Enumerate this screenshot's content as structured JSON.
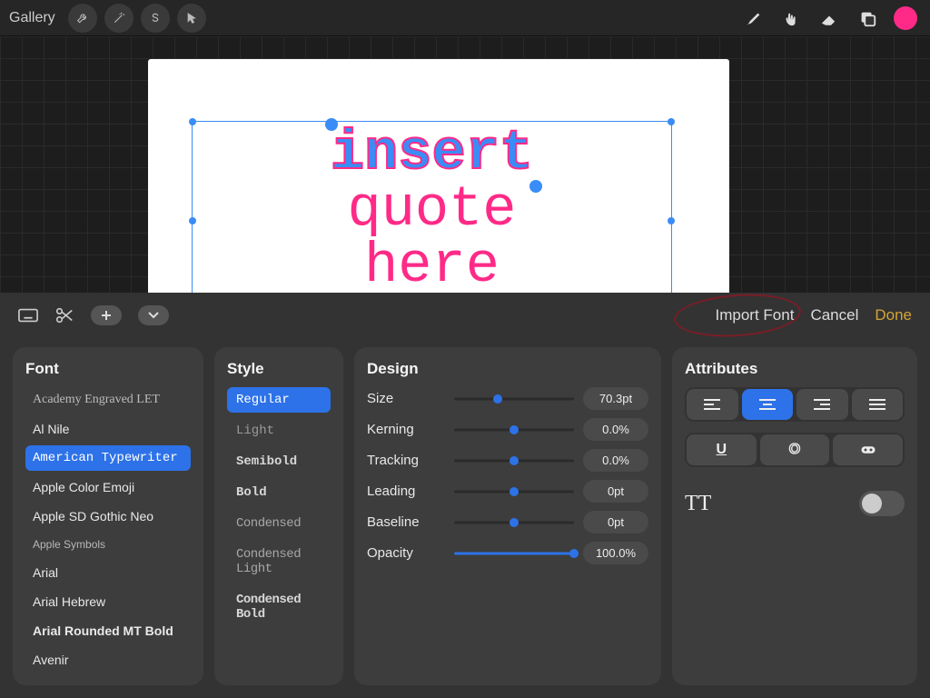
{
  "topbar": {
    "gallery_label": "Gallery"
  },
  "canvas": {
    "selected_word": "insert",
    "line2": "quote",
    "line3": "here"
  },
  "panel_toolbar": {
    "import_font": "Import Font",
    "cancel": "Cancel",
    "done": "Done"
  },
  "font_panel": {
    "title": "Font",
    "items": [
      "Academy Engraved LET",
      "Al Nile",
      "American Typewriter",
      "Apple Color Emoji",
      "Apple SD Gothic Neo",
      "Apple Symbols",
      "Arial",
      "Arial Hebrew",
      "Arial Rounded MT Bold",
      "Avenir"
    ],
    "selected_index": 2
  },
  "style_panel": {
    "title": "Style",
    "items": [
      "Regular",
      "Light",
      "Semibold",
      "Bold",
      "Condensed",
      "Condensed Light",
      "Condensed Bold"
    ],
    "selected_index": 0
  },
  "design_panel": {
    "title": "Design",
    "rows": [
      {
        "label": "Size",
        "value": "70.3pt",
        "thumb_pct": 36
      },
      {
        "label": "Kerning",
        "value": "0.0%",
        "thumb_pct": 50
      },
      {
        "label": "Tracking",
        "value": "0.0%",
        "thumb_pct": 50
      },
      {
        "label": "Leading",
        "value": "0pt",
        "thumb_pct": 50
      },
      {
        "label": "Baseline",
        "value": "0pt",
        "thumb_pct": 50
      },
      {
        "label": "Opacity",
        "value": "100.0%",
        "thumb_pct": 100
      }
    ]
  },
  "attr_panel": {
    "title": "Attributes",
    "align_selected_index": 1,
    "caps_label": "TT",
    "caps_on": false
  }
}
